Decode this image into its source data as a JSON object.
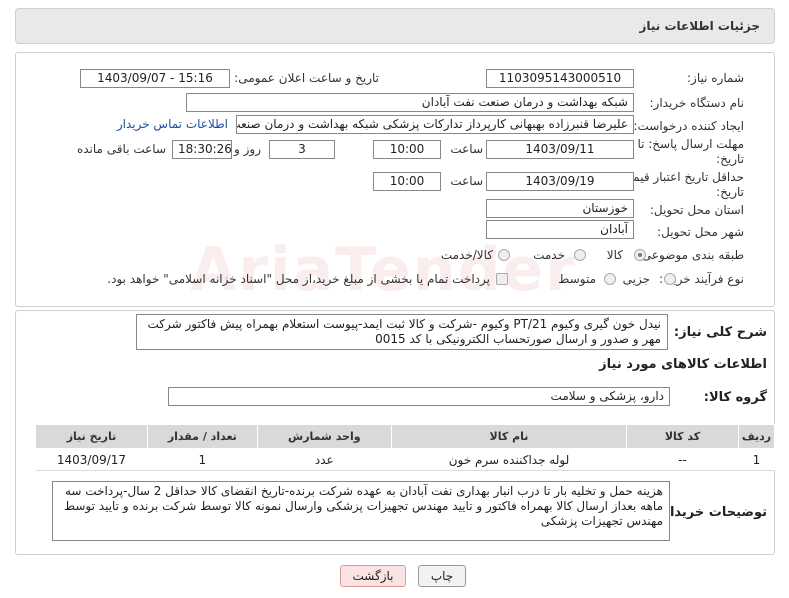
{
  "panel_title": "جزئیات اطلاعات نیاز",
  "fields": {
    "need_number_label": "شماره نیاز:",
    "need_number": "1103095143000510",
    "announce_label": "تاریخ و ساعت اعلان عمومی:",
    "announce_value": "1403/09/07 - 15:16",
    "buyer_label": "نام دستگاه خریدار:",
    "buyer_value": "شبکه بهداشت و درمان صنعت نفت آبادان",
    "creator_label": "ایجاد کننده درخواست:",
    "creator_value": "علیرضا قنبرزاده بهبهانی کارپرداز تدارکات پزشکی شبکه بهداشت و درمان صنعت",
    "contact_link": "اطلاعات تماس خریدار",
    "deadline_label_1": "مهلت ارسال پاسخ: تا",
    "deadline_label_2": "تاریخ:",
    "deadline_date": "1403/09/11",
    "time_label": "ساعت",
    "deadline_time": "10:00",
    "days_value": "3",
    "days_label": "روز و",
    "remaining_time": "18:30:26",
    "remaining_label": "ساعت باقی مانده",
    "validity_label_1": "حداقل تاریخ اعتبار قیمت: تا",
    "validity_label_2": "تاریخ:",
    "validity_date": "1403/09/19",
    "validity_time": "10:00",
    "province_label": "استان محل تحویل:",
    "province_value": "خوزستان",
    "city_label": "شهر محل تحویل:",
    "city_value": "آبادان",
    "category_label": "طبقه بندی موضوعی:",
    "category_goods": "کالا",
    "category_service": "خدمت",
    "category_both": "کالا/خدمت",
    "process_label": "نوع فرآیند خرید :",
    "process_partial": "جزیی",
    "process_medium": "متوسط",
    "payment_note": "پرداخت تمام یا بخشی از مبلغ خرید،از محل \"اسناد خزانه اسلامی\" خواهد بود."
  },
  "description": {
    "label": "شرح کلی نیاز:",
    "text": "نیدل خون گیری وکیوم PT/21 وکیوم -شرکت و کالا ثبت ایمد-پیوست استعلام بهمراه پیش فاکتور شرکت مهر و صدور و ارسال صورتحساب الکترونیکی با کد 0015"
  },
  "goods_info_title": "اطلاعات کالاهای مورد نیاز",
  "goods_group": {
    "label": "گروه کالا:",
    "value": "دارو، پزشکی و سلامت"
  },
  "table": {
    "headers": [
      "ردیف",
      "کد کالا",
      "نام کالا",
      "واحد شمارش",
      "تعداد / مقدار",
      "تاریخ نیاز"
    ],
    "rows": [
      [
        "1",
        "--",
        "لوله جداکننده سرم خون",
        "عدد",
        "1",
        "1403/09/17"
      ]
    ]
  },
  "buyer_notes": {
    "label": "توضیحات خریدار:",
    "text": "هزینه حمل و تخلیه بار تا درب انبار بهداری نفت آبادان به عهده شرکت برنده-تاریخ انقضای کالا حداقل 2 سال-پرداخت سه ماهه بعداز ارسال کالا بهمراه فاکتور و تایید مهندس تجهیزات پزشکی وارسال نمونه کالا توسط شرکت برنده و تایید توسط مهندس تجهیزات پزشکی"
  },
  "buttons": {
    "print": "چاپ",
    "back": "بازگشت"
  },
  "colors": {
    "link": "#1a4fa3",
    "back_button_bg": "#fbe3e3",
    "header_bg": "#e9e9e9"
  }
}
